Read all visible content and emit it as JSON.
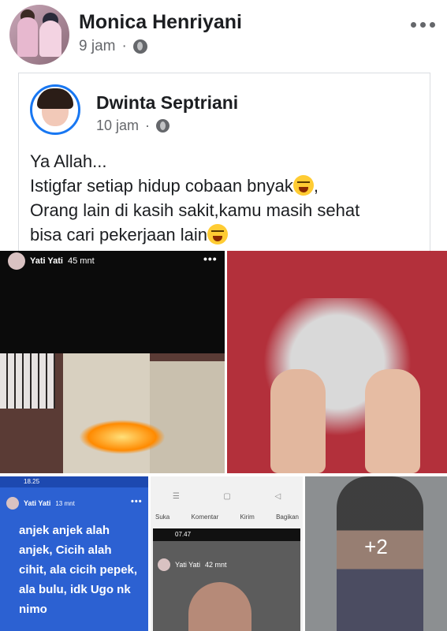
{
  "post": {
    "author": "Monica Henriyani",
    "time": "9 jam",
    "separator": "·",
    "privacy_icon": "globe-icon",
    "more_icon": "more-horizontal-icon"
  },
  "shared": {
    "author": "Dwinta Septriani",
    "time": "10 jam",
    "separator": "·",
    "privacy_icon": "globe-icon",
    "text_line1": "Ya Allah...",
    "text_line2": "Istigfar setiap hidup cobaan bnyak",
    "text_line2_end": ",",
    "text_line3": "Orang lain di kasih sakit,kamu masih sehat",
    "text_line4": "bisa cari pekerjaan lain",
    "emoji": "loudly-crying-face-emoji"
  },
  "photo1": {
    "user": "Yati Yati",
    "time": "45 mnt",
    "dots": "•••"
  },
  "photo3": {
    "status_time": "18.25",
    "user": "Yati Yati",
    "time": "13 mnt",
    "dots": "•••",
    "story_text": "anjek anjek alah anjek, Cicih alah cihit, ala cicih pepek, ala bulu, idk Ugo nk nimo"
  },
  "photo4": {
    "actions": [
      "Suka",
      "Komentar",
      "Kirim",
      "Bagikan"
    ],
    "inner_status_time": "07.47",
    "inner_user": "Yati Yati",
    "inner_time": "42 mnt"
  },
  "photo5": {
    "overlay_count": "+2"
  }
}
